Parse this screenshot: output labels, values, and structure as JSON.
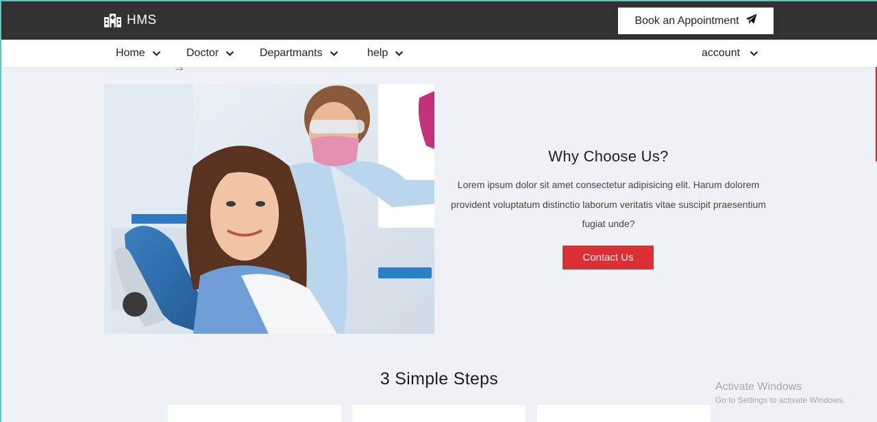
{
  "header": {
    "brand_name": "HMS",
    "brand_icon": "hospital-icon",
    "book_button_label": "Book an Appointment",
    "book_button_icon": "paper-plane-icon"
  },
  "nav": {
    "items": [
      {
        "label": "Home"
      },
      {
        "label": "Doctor"
      },
      {
        "label": "Departmants"
      },
      {
        "label": "help"
      }
    ],
    "account_label": "account"
  },
  "stray_text": "-->",
  "why": {
    "title": "Why Choose Us?",
    "text": "Lorem ipsum dolor sit amet consectetur adipisicing elit. Harum dolorem provident voluptatum distinctio laborum veritatis vitae suscipit praesentium fugiat unde?",
    "button_label": "Contact Us"
  },
  "steps": {
    "title": "3 Simple Steps"
  },
  "watermark": {
    "line1": "Activate Windows",
    "line2": "Go to Settings to activate Windows."
  },
  "colors": {
    "topbar": "#333131",
    "accent_red": "#dc2f34",
    "page_bg": "#eef1f5"
  }
}
